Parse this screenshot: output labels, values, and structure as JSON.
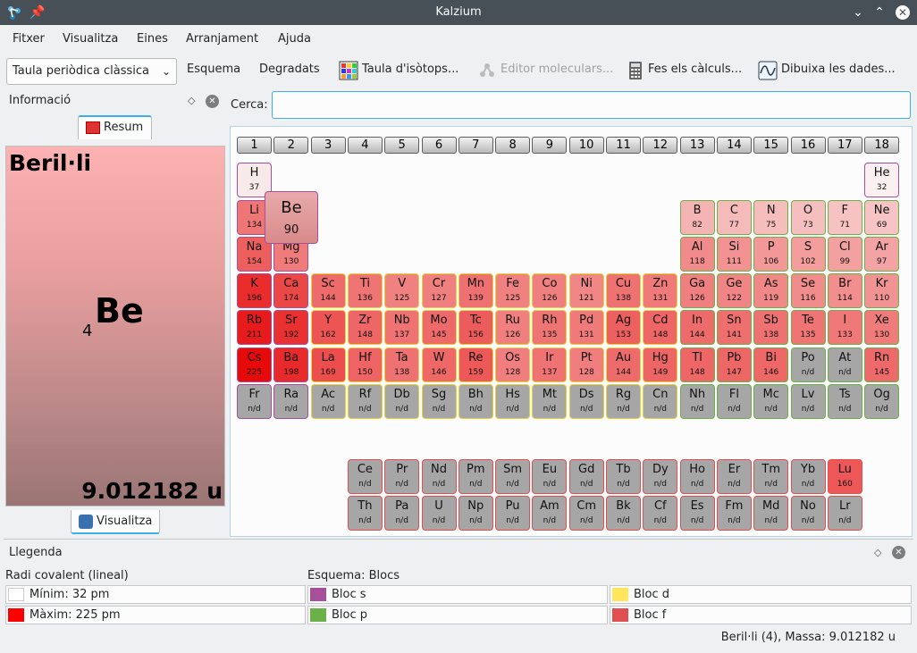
{
  "window": {
    "title": "Kalzium"
  },
  "menu": [
    "Fitxer",
    "Visualitza",
    "Eines",
    "Arranjament",
    "Ajuda"
  ],
  "toolbar": {
    "table_select": "Taula periòdica clàssica",
    "scheme": "Esquema",
    "gradients": "Degradats",
    "isotopes": "Taula d'isòtops...",
    "molecule_editor": "Editor moleculars...",
    "calculations": "Fes els càlculs...",
    "plot": "Dibuixa les dades..."
  },
  "info": {
    "title": "Informació",
    "tab_summary": "Resum",
    "tab_view": "Visualitza",
    "element_name": "Beril·li",
    "atomic_number": "4",
    "symbol": "Be",
    "mass": "9.012182 u"
  },
  "search": {
    "label": "Cerca:",
    "value": ""
  },
  "groups": [
    "1",
    "2",
    "3",
    "4",
    "5",
    "6",
    "7",
    "8",
    "9",
    "10",
    "11",
    "12",
    "13",
    "14",
    "15",
    "16",
    "17",
    "18"
  ],
  "hover": {
    "symbol": "Be",
    "value": "90"
  },
  "legend": {
    "title": "Llegenda",
    "gradient_head": "Radi covalent (lineal)",
    "min_label": "Mínim: 32 pm",
    "max_label": "Màxim: 225 pm",
    "scheme_head": "Esquema: Blocs",
    "blocks": [
      "Bloc s",
      "Bloc p",
      "Bloc d",
      "Bloc f"
    ],
    "colors": {
      "min": "#ffffff",
      "max": "#ff0000",
      "s": "#a84f9c",
      "p": "#6cb148",
      "d": "#ffe65a",
      "f": "#e05050"
    }
  },
  "status": "Beril·li (4), Massa: 9.012182 u",
  "elements": [
    {
      "s": "H",
      "v": "37",
      "g": 1,
      "p": 1,
      "b": "s"
    },
    {
      "s": "He",
      "v": "32",
      "g": 18,
      "p": 1,
      "b": "s"
    },
    {
      "s": "Li",
      "v": "134",
      "g": 1,
      "p": 2,
      "b": "s"
    },
    {
      "s": "B",
      "v": "82",
      "g": 13,
      "p": 2,
      "b": "p"
    },
    {
      "s": "C",
      "v": "77",
      "g": 14,
      "p": 2,
      "b": "p"
    },
    {
      "s": "N",
      "v": "75",
      "g": 15,
      "p": 2,
      "b": "p"
    },
    {
      "s": "O",
      "v": "73",
      "g": 16,
      "p": 2,
      "b": "p"
    },
    {
      "s": "F",
      "v": "71",
      "g": 17,
      "p": 2,
      "b": "p"
    },
    {
      "s": "Ne",
      "v": "69",
      "g": 18,
      "p": 2,
      "b": "p"
    },
    {
      "s": "Na",
      "v": "154",
      "g": 1,
      "p": 3,
      "b": "s"
    },
    {
      "s": "Mg",
      "v": "130",
      "g": 2,
      "p": 3,
      "b": "s"
    },
    {
      "s": "Al",
      "v": "118",
      "g": 13,
      "p": 3,
      "b": "p"
    },
    {
      "s": "Si",
      "v": "111",
      "g": 14,
      "p": 3,
      "b": "p"
    },
    {
      "s": "P",
      "v": "106",
      "g": 15,
      "p": 3,
      "b": "p"
    },
    {
      "s": "S",
      "v": "102",
      "g": 16,
      "p": 3,
      "b": "p"
    },
    {
      "s": "Cl",
      "v": "99",
      "g": 17,
      "p": 3,
      "b": "p"
    },
    {
      "s": "Ar",
      "v": "97",
      "g": 18,
      "p": 3,
      "b": "p"
    },
    {
      "s": "K",
      "v": "196",
      "g": 1,
      "p": 4,
      "b": "s"
    },
    {
      "s": "Ca",
      "v": "174",
      "g": 2,
      "p": 4,
      "b": "s"
    },
    {
      "s": "Sc",
      "v": "144",
      "g": 3,
      "p": 4,
      "b": "d"
    },
    {
      "s": "Ti",
      "v": "136",
      "g": 4,
      "p": 4,
      "b": "d"
    },
    {
      "s": "V",
      "v": "125",
      "g": 5,
      "p": 4,
      "b": "d"
    },
    {
      "s": "Cr",
      "v": "127",
      "g": 6,
      "p": 4,
      "b": "d"
    },
    {
      "s": "Mn",
      "v": "139",
      "g": 7,
      "p": 4,
      "b": "d"
    },
    {
      "s": "Fe",
      "v": "125",
      "g": 8,
      "p": 4,
      "b": "d"
    },
    {
      "s": "Co",
      "v": "126",
      "g": 9,
      "p": 4,
      "b": "d"
    },
    {
      "s": "Ni",
      "v": "121",
      "g": 10,
      "p": 4,
      "b": "d"
    },
    {
      "s": "Cu",
      "v": "138",
      "g": 11,
      "p": 4,
      "b": "d"
    },
    {
      "s": "Zn",
      "v": "131",
      "g": 12,
      "p": 4,
      "b": "d"
    },
    {
      "s": "Ga",
      "v": "126",
      "g": 13,
      "p": 4,
      "b": "p"
    },
    {
      "s": "Ge",
      "v": "122",
      "g": 14,
      "p": 4,
      "b": "p"
    },
    {
      "s": "As",
      "v": "119",
      "g": 15,
      "p": 4,
      "b": "p"
    },
    {
      "s": "Se",
      "v": "116",
      "g": 16,
      "p": 4,
      "b": "p"
    },
    {
      "s": "Br",
      "v": "114",
      "g": 17,
      "p": 4,
      "b": "p"
    },
    {
      "s": "Kr",
      "v": "110",
      "g": 18,
      "p": 4,
      "b": "p"
    },
    {
      "s": "Rb",
      "v": "211",
      "g": 1,
      "p": 5,
      "b": "s"
    },
    {
      "s": "Sr",
      "v": "192",
      "g": 2,
      "p": 5,
      "b": "s"
    },
    {
      "s": "Y",
      "v": "162",
      "g": 3,
      "p": 5,
      "b": "d"
    },
    {
      "s": "Zr",
      "v": "148",
      "g": 4,
      "p": 5,
      "b": "d"
    },
    {
      "s": "Nb",
      "v": "137",
      "g": 5,
      "p": 5,
      "b": "d"
    },
    {
      "s": "Mo",
      "v": "145",
      "g": 6,
      "p": 5,
      "b": "d"
    },
    {
      "s": "Tc",
      "v": "156",
      "g": 7,
      "p": 5,
      "b": "d"
    },
    {
      "s": "Ru",
      "v": "126",
      "g": 8,
      "p": 5,
      "b": "d"
    },
    {
      "s": "Rh",
      "v": "135",
      "g": 9,
      "p": 5,
      "b": "d"
    },
    {
      "s": "Pd",
      "v": "131",
      "g": 10,
      "p": 5,
      "b": "d"
    },
    {
      "s": "Ag",
      "v": "153",
      "g": 11,
      "p": 5,
      "b": "d"
    },
    {
      "s": "Cd",
      "v": "148",
      "g": 12,
      "p": 5,
      "b": "d"
    },
    {
      "s": "In",
      "v": "144",
      "g": 13,
      "p": 5,
      "b": "p"
    },
    {
      "s": "Sn",
      "v": "141",
      "g": 14,
      "p": 5,
      "b": "p"
    },
    {
      "s": "Sb",
      "v": "138",
      "g": 15,
      "p": 5,
      "b": "p"
    },
    {
      "s": "Te",
      "v": "135",
      "g": 16,
      "p": 5,
      "b": "p"
    },
    {
      "s": "I",
      "v": "133",
      "g": 17,
      "p": 5,
      "b": "p"
    },
    {
      "s": "Xe",
      "v": "130",
      "g": 18,
      "p": 5,
      "b": "p"
    },
    {
      "s": "Cs",
      "v": "225",
      "g": 1,
      "p": 6,
      "b": "s"
    },
    {
      "s": "Ba",
      "v": "198",
      "g": 2,
      "p": 6,
      "b": "s"
    },
    {
      "s": "La",
      "v": "169",
      "g": 3,
      "p": 6,
      "b": "d"
    },
    {
      "s": "Hf",
      "v": "150",
      "g": 4,
      "p": 6,
      "b": "d"
    },
    {
      "s": "Ta",
      "v": "138",
      "g": 5,
      "p": 6,
      "b": "d"
    },
    {
      "s": "W",
      "v": "146",
      "g": 6,
      "p": 6,
      "b": "d"
    },
    {
      "s": "Re",
      "v": "159",
      "g": 7,
      "p": 6,
      "b": "d"
    },
    {
      "s": "Os",
      "v": "128",
      "g": 8,
      "p": 6,
      "b": "d"
    },
    {
      "s": "Ir",
      "v": "137",
      "g": 9,
      "p": 6,
      "b": "d"
    },
    {
      "s": "Pt",
      "v": "128",
      "g": 10,
      "p": 6,
      "b": "d"
    },
    {
      "s": "Au",
      "v": "144",
      "g": 11,
      "p": 6,
      "b": "d"
    },
    {
      "s": "Hg",
      "v": "149",
      "g": 12,
      "p": 6,
      "b": "d"
    },
    {
      "s": "Tl",
      "v": "148",
      "g": 13,
      "p": 6,
      "b": "p"
    },
    {
      "s": "Pb",
      "v": "147",
      "g": 14,
      "p": 6,
      "b": "p"
    },
    {
      "s": "Bi",
      "v": "146",
      "g": 15,
      "p": 6,
      "b": "p"
    },
    {
      "s": "Po",
      "v": "n/d",
      "g": 16,
      "p": 6,
      "b": "p"
    },
    {
      "s": "At",
      "v": "n/d",
      "g": 17,
      "p": 6,
      "b": "p"
    },
    {
      "s": "Rn",
      "v": "145",
      "g": 18,
      "p": 6,
      "b": "p"
    },
    {
      "s": "Fr",
      "v": "n/d",
      "g": 1,
      "p": 7,
      "b": "s"
    },
    {
      "s": "Ra",
      "v": "n/d",
      "g": 2,
      "p": 7,
      "b": "s"
    },
    {
      "s": "Ac",
      "v": "n/d",
      "g": 3,
      "p": 7,
      "b": "d"
    },
    {
      "s": "Rf",
      "v": "n/d",
      "g": 4,
      "p": 7,
      "b": "d"
    },
    {
      "s": "Db",
      "v": "n/d",
      "g": 5,
      "p": 7,
      "b": "d"
    },
    {
      "s": "Sg",
      "v": "n/d",
      "g": 6,
      "p": 7,
      "b": "d"
    },
    {
      "s": "Bh",
      "v": "n/d",
      "g": 7,
      "p": 7,
      "b": "d"
    },
    {
      "s": "Hs",
      "v": "n/d",
      "g": 8,
      "p": 7,
      "b": "d"
    },
    {
      "s": "Mt",
      "v": "n/d",
      "g": 9,
      "p": 7,
      "b": "d"
    },
    {
      "s": "Ds",
      "v": "n/d",
      "g": 10,
      "p": 7,
      "b": "d"
    },
    {
      "s": "Rg",
      "v": "n/d",
      "g": 11,
      "p": 7,
      "b": "d"
    },
    {
      "s": "Cn",
      "v": "n/d",
      "g": 12,
      "p": 7,
      "b": "d"
    },
    {
      "s": "Nh",
      "v": "n/d",
      "g": 13,
      "p": 7,
      "b": "p"
    },
    {
      "s": "Fl",
      "v": "n/d",
      "g": 14,
      "p": 7,
      "b": "p"
    },
    {
      "s": "Mc",
      "v": "n/d",
      "g": 15,
      "p": 7,
      "b": "p"
    },
    {
      "s": "Lv",
      "v": "n/d",
      "g": 16,
      "p": 7,
      "b": "p"
    },
    {
      "s": "Ts",
      "v": "n/d",
      "g": 17,
      "p": 7,
      "b": "p"
    },
    {
      "s": "Og",
      "v": "n/d",
      "g": 18,
      "p": 7,
      "b": "p"
    },
    {
      "s": "Ce",
      "v": "n/d",
      "g": 4,
      "p": 9,
      "b": "f"
    },
    {
      "s": "Pr",
      "v": "n/d",
      "g": 5,
      "p": 9,
      "b": "f"
    },
    {
      "s": "Nd",
      "v": "n/d",
      "g": 6,
      "p": 9,
      "b": "f"
    },
    {
      "s": "Pm",
      "v": "n/d",
      "g": 7,
      "p": 9,
      "b": "f"
    },
    {
      "s": "Sm",
      "v": "n/d",
      "g": 8,
      "p": 9,
      "b": "f"
    },
    {
      "s": "Eu",
      "v": "n/d",
      "g": 9,
      "p": 9,
      "b": "f"
    },
    {
      "s": "Gd",
      "v": "n/d",
      "g": 10,
      "p": 9,
      "b": "f"
    },
    {
      "s": "Tb",
      "v": "n/d",
      "g": 11,
      "p": 9,
      "b": "f"
    },
    {
      "s": "Dy",
      "v": "n/d",
      "g": 12,
      "p": 9,
      "b": "f"
    },
    {
      "s": "Ho",
      "v": "n/d",
      "g": 13,
      "p": 9,
      "b": "f"
    },
    {
      "s": "Er",
      "v": "n/d",
      "g": 14,
      "p": 9,
      "b": "f"
    },
    {
      "s": "Tm",
      "v": "n/d",
      "g": 15,
      "p": 9,
      "b": "f"
    },
    {
      "s": "Yb",
      "v": "n/d",
      "g": 16,
      "p": 9,
      "b": "f"
    },
    {
      "s": "Lu",
      "v": "160",
      "g": 17,
      "p": 9,
      "b": "f"
    },
    {
      "s": "Th",
      "v": "n/d",
      "g": 4,
      "p": 10,
      "b": "f"
    },
    {
      "s": "Pa",
      "v": "n/d",
      "g": 5,
      "p": 10,
      "b": "f"
    },
    {
      "s": "U",
      "v": "n/d",
      "g": 6,
      "p": 10,
      "b": "f"
    },
    {
      "s": "Np",
      "v": "n/d",
      "g": 7,
      "p": 10,
      "b": "f"
    },
    {
      "s": "Pu",
      "v": "n/d",
      "g": 8,
      "p": 10,
      "b": "f"
    },
    {
      "s": "Am",
      "v": "n/d",
      "g": 9,
      "p": 10,
      "b": "f"
    },
    {
      "s": "Cm",
      "v": "n/d",
      "g": 10,
      "p": 10,
      "b": "f"
    },
    {
      "s": "Bk",
      "v": "n/d",
      "g": 11,
      "p": 10,
      "b": "f"
    },
    {
      "s": "Cf",
      "v": "n/d",
      "g": 12,
      "p": 10,
      "b": "f"
    },
    {
      "s": "Es",
      "v": "n/d",
      "g": 13,
      "p": 10,
      "b": "f"
    },
    {
      "s": "Fm",
      "v": "n/d",
      "g": 14,
      "p": 10,
      "b": "f"
    },
    {
      "s": "Md",
      "v": "n/d",
      "g": 15,
      "p": 10,
      "b": "f"
    },
    {
      "s": "No",
      "v": "n/d",
      "g": 16,
      "p": 10,
      "b": "f"
    },
    {
      "s": "Lr",
      "v": "n/d",
      "g": 17,
      "p": 10,
      "b": "f"
    }
  ]
}
